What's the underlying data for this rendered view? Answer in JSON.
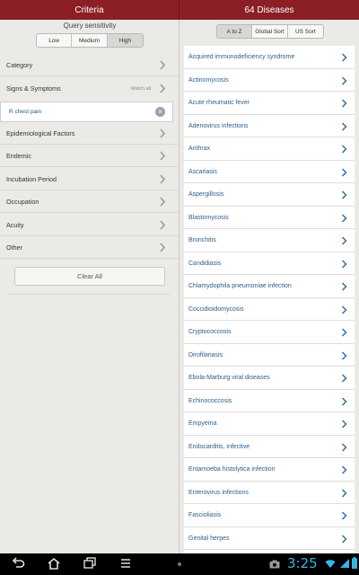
{
  "header": {
    "left_title": "Criteria",
    "right_title": "64 Diseases"
  },
  "criteria": {
    "sensitivity_title": "Query sensitivity",
    "sensitivity_options": [
      "Low",
      "Medium",
      "High"
    ],
    "sensitivity_selected": "High",
    "rows": [
      {
        "label": "Category"
      },
      {
        "label": "Signs & Symptoms",
        "extra": "Match all"
      },
      {
        "label": "Epidemiological Factors"
      },
      {
        "label": "Endemic"
      },
      {
        "label": "Incubation Period"
      },
      {
        "label": "Occupation"
      },
      {
        "label": "Acuity"
      },
      {
        "label": "Other"
      }
    ],
    "selected_symptom": "R  chest pain",
    "clear_all_label": "Clear All"
  },
  "sort": {
    "options": [
      "A to Z",
      "Global Sort",
      "US Sort"
    ],
    "selected": "A to Z"
  },
  "diseases": [
    "Acquired immunodeficiency syndrome",
    "Actinomycosis",
    "Acute rheumatic fever",
    "Adenovirus infections",
    "Anthrax",
    "Ascariasis",
    "Aspergillosis",
    "Blastomycosis",
    "Bronchitis",
    "Candidiasis",
    "Chlamydophila pneumoniae infection",
    "Coccidioidomycosis",
    "Cryptococcosis",
    "Dirofilariasis",
    "Ebola-Marburg viral diseases",
    "Echinococcosis",
    "Empyema",
    "Endocarditis, infective",
    "Entamoeba histolytica infection",
    "Enterovirus infections",
    "Fascioliasis",
    "Genital herpes"
  ],
  "status": {
    "time": "3:25"
  },
  "colors": {
    "header": "#8c1f25",
    "link": "#2b5e8c",
    "clock": "#35b6e6"
  }
}
